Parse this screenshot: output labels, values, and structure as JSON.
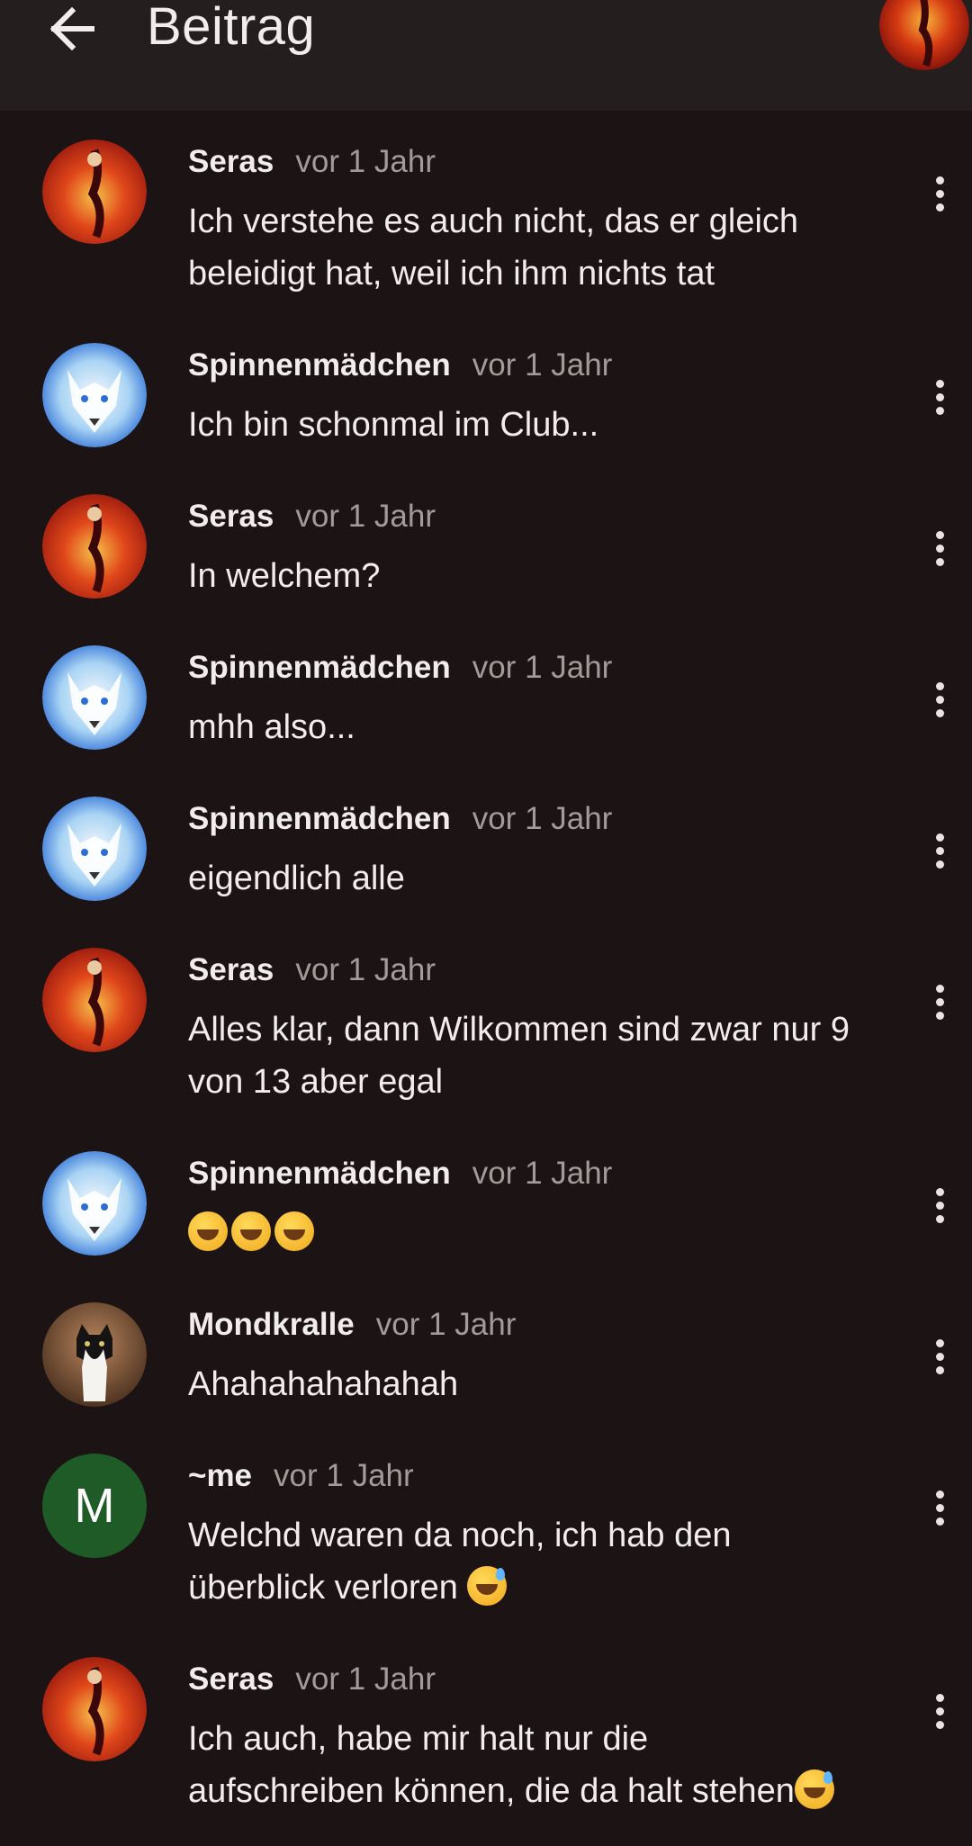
{
  "appbar": {
    "title": "Beitrag"
  },
  "comments": [
    {
      "author": "Seras",
      "time": "vor 1 Jahr",
      "avatar": "fire-avatar",
      "lines": [
        "Ich verstehe es auch nicht, das er gleich",
        "beleidigt hat, weil ich ihm nichts tat"
      ]
    },
    {
      "author": "Spinnenmädchen",
      "time": "vor 1 Jahr",
      "avatar": "wolf-avatar",
      "lines": [
        "Ich bin schonmal im Club..."
      ]
    },
    {
      "author": "Seras",
      "time": "vor 1 Jahr",
      "avatar": "fire-avatar",
      "lines": [
        "In welchem?"
      ]
    },
    {
      "author": "Spinnenmädchen",
      "time": "vor 1 Jahr",
      "avatar": "wolf-avatar",
      "lines": [
        "mhh also..."
      ]
    },
    {
      "author": "Spinnenmädchen",
      "time": "vor 1 Jahr",
      "avatar": "wolf-avatar",
      "lines": [
        "eigendlich alle"
      ]
    },
    {
      "author": "Seras",
      "time": "vor 1 Jahr",
      "avatar": "fire-avatar",
      "lines": [
        "Alles klar, dann Wilkommen sind zwar nur 9",
        "von 13 aber egal"
      ]
    },
    {
      "author": "Spinnenmädchen",
      "time": "vor 1 Jahr",
      "avatar": "wolf-avatar",
      "lines": [
        ""
      ]
    },
    {
      "author": "Mondkralle",
      "time": "vor 1 Jahr",
      "avatar": "cat-avatar",
      "lines": [
        "Ahahahahahahah"
      ]
    },
    {
      "author": "~me",
      "time": "vor 1 Jahr",
      "avatar": "letter-avatar",
      "avatar_letter": "M",
      "lines": [
        "Welchd waren da noch, ich hab den",
        "überblick verloren"
      ]
    },
    {
      "author": "Seras",
      "time": "vor 1 Jahr",
      "avatar": "fire-avatar",
      "lines": [
        "Ich auch, habe mir halt nur die",
        "aufschreiben können, die da halt stehen"
      ]
    }
  ],
  "colors": {
    "background": "#1b1314",
    "appbar": "#241e1f",
    "time": "#a39a9a",
    "me_avatar": "#1f5b26"
  }
}
